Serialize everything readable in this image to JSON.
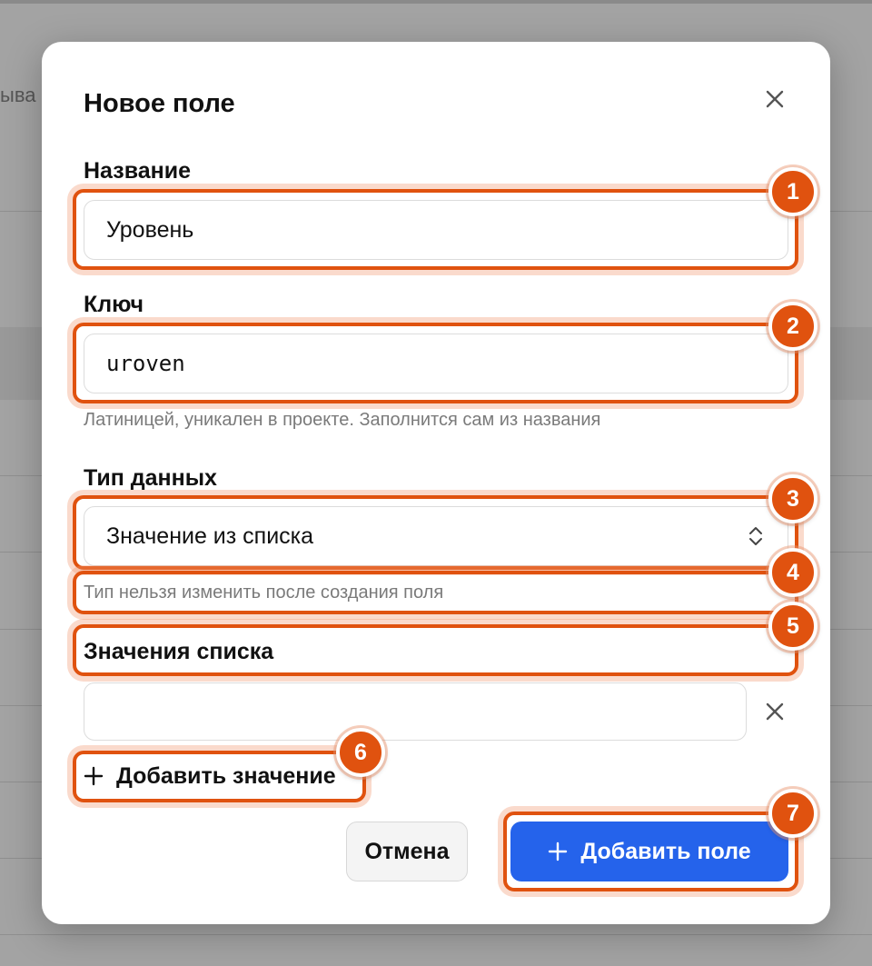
{
  "background": {
    "partial_text_left": "ыва",
    "partial_text_bottom": "- ··· ‹ ·· ·"
  },
  "modal": {
    "title": "Новое поле",
    "close_icon": "close-icon",
    "name_field": {
      "label": "Название",
      "value": "Уровень"
    },
    "key_field": {
      "label": "Ключ",
      "value": "uroven",
      "hint": "Латиницей, уникален в проекте. Заполнится сам из названия"
    },
    "type_field": {
      "label": "Тип данных",
      "selected": "Значение из списка",
      "hint": "Тип нельзя изменить после создания поля"
    },
    "list_values": {
      "label": "Значения списка",
      "items": [
        ""
      ],
      "remove_icon": "close-icon",
      "add_label": "Добавить значение"
    },
    "buttons": {
      "cancel": "Отмена",
      "submit": "Добавить поле"
    }
  },
  "annotations": {
    "color": "#e0520f",
    "badges": [
      "1",
      "2",
      "3",
      "4",
      "5",
      "6",
      "7"
    ]
  },
  "colors": {
    "primary": "#2563eb",
    "annotation": "#e0520f",
    "overlay": "#a3a3a3"
  }
}
